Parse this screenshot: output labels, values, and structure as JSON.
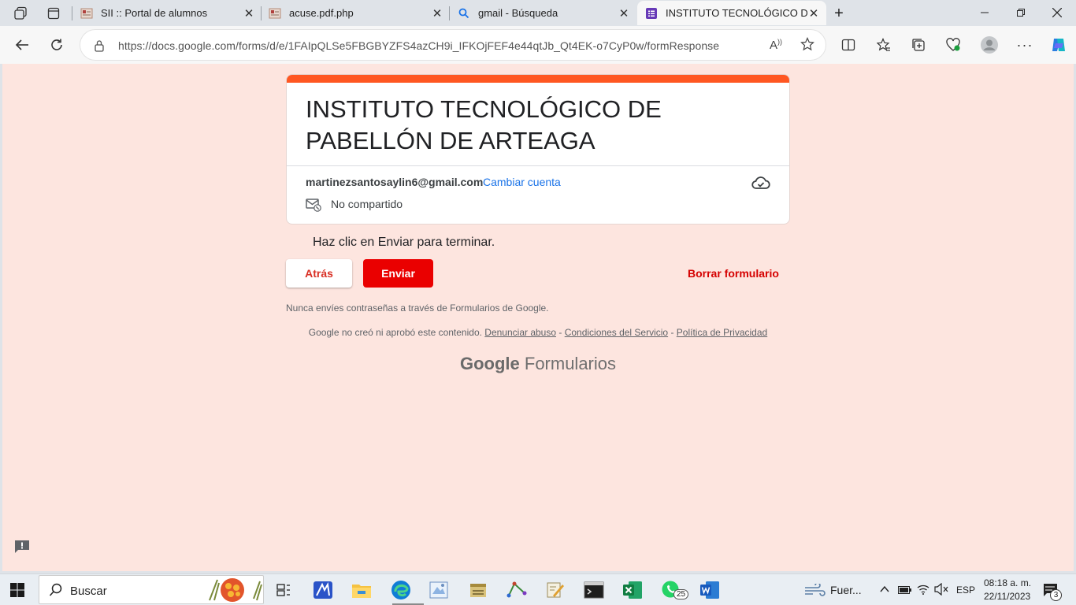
{
  "browser": {
    "tabs": [
      {
        "title": "SII :: Portal de alumnos",
        "icon": "sii-favicon"
      },
      {
        "title": "acuse.pdf.php",
        "icon": "sii-favicon"
      },
      {
        "title": "gmail - Búsqueda",
        "icon": "search-icon"
      },
      {
        "title": "INSTITUTO TECNOLÓGICO DE PA",
        "icon": "forms-icon",
        "active": true
      }
    ],
    "url": "https://docs.google.com/forms/d/e/1FAIpQLSe5FBGBYZFS4azCH9i_IFKOjFEF4e44qtJb_Qt4EK-o7CyP0w/formResponse"
  },
  "form": {
    "title": "INSTITUTO TECNOLÓGICO DE PABELLÓN DE ARTEAGA",
    "email": "martinezsantosaylin6@gmail.com",
    "switch_account": "Cambiar cuenta",
    "not_shared": "No compartido",
    "instruction": "Haz clic en Enviar para terminar.",
    "back_label": "Atrás",
    "send_label": "Enviar",
    "clear_label": "Borrar formulario",
    "warning": "Nunca envíes contraseñas a través de Formularios de Google.",
    "legal_text": "Google no creó ni aprobó este contenido.",
    "report_abuse": "Denunciar abuso",
    "terms": "Condiciones del Servicio",
    "privacy": "Política de Privacidad",
    "sep": " - ",
    "logo_google": "Google",
    "logo_forms": "Formularios",
    "accent_color": "#ff5722",
    "background_color": "#fde5df"
  },
  "taskbar": {
    "search_placeholder": "Buscar",
    "weather": "Fuer...",
    "language": "ESP",
    "time": "08:18 a. m.",
    "date": "22/11/2023",
    "whatsapp_badge": "25",
    "notification_count": "3"
  }
}
